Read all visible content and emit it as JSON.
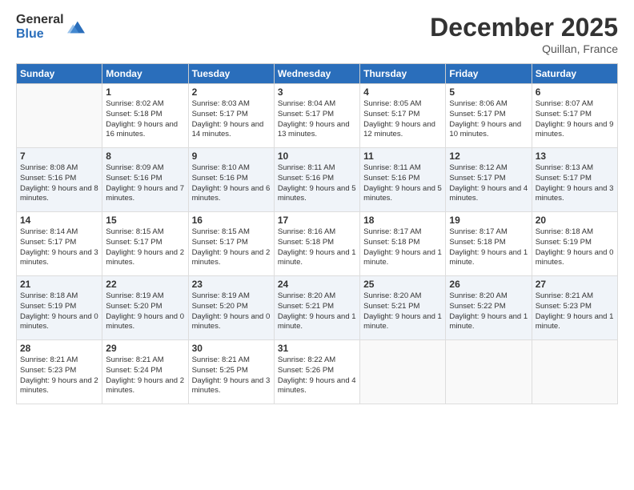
{
  "header": {
    "logo_general": "General",
    "logo_blue": "Blue",
    "title": "December 2025",
    "location": "Quillan, France"
  },
  "weekdays": [
    "Sunday",
    "Monday",
    "Tuesday",
    "Wednesday",
    "Thursday",
    "Friday",
    "Saturday"
  ],
  "weeks": [
    [
      {
        "day": "",
        "sunrise": "",
        "sunset": "",
        "daylight": ""
      },
      {
        "day": "1",
        "sunrise": "Sunrise: 8:02 AM",
        "sunset": "Sunset: 5:18 PM",
        "daylight": "Daylight: 9 hours and 16 minutes."
      },
      {
        "day": "2",
        "sunrise": "Sunrise: 8:03 AM",
        "sunset": "Sunset: 5:17 PM",
        "daylight": "Daylight: 9 hours and 14 minutes."
      },
      {
        "day": "3",
        "sunrise": "Sunrise: 8:04 AM",
        "sunset": "Sunset: 5:17 PM",
        "daylight": "Daylight: 9 hours and 13 minutes."
      },
      {
        "day": "4",
        "sunrise": "Sunrise: 8:05 AM",
        "sunset": "Sunset: 5:17 PM",
        "daylight": "Daylight: 9 hours and 12 minutes."
      },
      {
        "day": "5",
        "sunrise": "Sunrise: 8:06 AM",
        "sunset": "Sunset: 5:17 PM",
        "daylight": "Daylight: 9 hours and 10 minutes."
      },
      {
        "day": "6",
        "sunrise": "Sunrise: 8:07 AM",
        "sunset": "Sunset: 5:17 PM",
        "daylight": "Daylight: 9 hours and 9 minutes."
      }
    ],
    [
      {
        "day": "7",
        "sunrise": "Sunrise: 8:08 AM",
        "sunset": "Sunset: 5:16 PM",
        "daylight": "Daylight: 9 hours and 8 minutes."
      },
      {
        "day": "8",
        "sunrise": "Sunrise: 8:09 AM",
        "sunset": "Sunset: 5:16 PM",
        "daylight": "Daylight: 9 hours and 7 minutes."
      },
      {
        "day": "9",
        "sunrise": "Sunrise: 8:10 AM",
        "sunset": "Sunset: 5:16 PM",
        "daylight": "Daylight: 9 hours and 6 minutes."
      },
      {
        "day": "10",
        "sunrise": "Sunrise: 8:11 AM",
        "sunset": "Sunset: 5:16 PM",
        "daylight": "Daylight: 9 hours and 5 minutes."
      },
      {
        "day": "11",
        "sunrise": "Sunrise: 8:11 AM",
        "sunset": "Sunset: 5:16 PM",
        "daylight": "Daylight: 9 hours and 5 minutes."
      },
      {
        "day": "12",
        "sunrise": "Sunrise: 8:12 AM",
        "sunset": "Sunset: 5:17 PM",
        "daylight": "Daylight: 9 hours and 4 minutes."
      },
      {
        "day": "13",
        "sunrise": "Sunrise: 8:13 AM",
        "sunset": "Sunset: 5:17 PM",
        "daylight": "Daylight: 9 hours and 3 minutes."
      }
    ],
    [
      {
        "day": "14",
        "sunrise": "Sunrise: 8:14 AM",
        "sunset": "Sunset: 5:17 PM",
        "daylight": "Daylight: 9 hours and 3 minutes."
      },
      {
        "day": "15",
        "sunrise": "Sunrise: 8:15 AM",
        "sunset": "Sunset: 5:17 PM",
        "daylight": "Daylight: 9 hours and 2 minutes."
      },
      {
        "day": "16",
        "sunrise": "Sunrise: 8:15 AM",
        "sunset": "Sunset: 5:17 PM",
        "daylight": "Daylight: 9 hours and 2 minutes."
      },
      {
        "day": "17",
        "sunrise": "Sunrise: 8:16 AM",
        "sunset": "Sunset: 5:18 PM",
        "daylight": "Daylight: 9 hours and 1 minute."
      },
      {
        "day": "18",
        "sunrise": "Sunrise: 8:17 AM",
        "sunset": "Sunset: 5:18 PM",
        "daylight": "Daylight: 9 hours and 1 minute."
      },
      {
        "day": "19",
        "sunrise": "Sunrise: 8:17 AM",
        "sunset": "Sunset: 5:18 PM",
        "daylight": "Daylight: 9 hours and 1 minute."
      },
      {
        "day": "20",
        "sunrise": "Sunrise: 8:18 AM",
        "sunset": "Sunset: 5:19 PM",
        "daylight": "Daylight: 9 hours and 0 minutes."
      }
    ],
    [
      {
        "day": "21",
        "sunrise": "Sunrise: 8:18 AM",
        "sunset": "Sunset: 5:19 PM",
        "daylight": "Daylight: 9 hours and 0 minutes."
      },
      {
        "day": "22",
        "sunrise": "Sunrise: 8:19 AM",
        "sunset": "Sunset: 5:20 PM",
        "daylight": "Daylight: 9 hours and 0 minutes."
      },
      {
        "day": "23",
        "sunrise": "Sunrise: 8:19 AM",
        "sunset": "Sunset: 5:20 PM",
        "daylight": "Daylight: 9 hours and 0 minutes."
      },
      {
        "day": "24",
        "sunrise": "Sunrise: 8:20 AM",
        "sunset": "Sunset: 5:21 PM",
        "daylight": "Daylight: 9 hours and 1 minute."
      },
      {
        "day": "25",
        "sunrise": "Sunrise: 8:20 AM",
        "sunset": "Sunset: 5:21 PM",
        "daylight": "Daylight: 9 hours and 1 minute."
      },
      {
        "day": "26",
        "sunrise": "Sunrise: 8:20 AM",
        "sunset": "Sunset: 5:22 PM",
        "daylight": "Daylight: 9 hours and 1 minute."
      },
      {
        "day": "27",
        "sunrise": "Sunrise: 8:21 AM",
        "sunset": "Sunset: 5:23 PM",
        "daylight": "Daylight: 9 hours and 1 minute."
      }
    ],
    [
      {
        "day": "28",
        "sunrise": "Sunrise: 8:21 AM",
        "sunset": "Sunset: 5:23 PM",
        "daylight": "Daylight: 9 hours and 2 minutes."
      },
      {
        "day": "29",
        "sunrise": "Sunrise: 8:21 AM",
        "sunset": "Sunset: 5:24 PM",
        "daylight": "Daylight: 9 hours and 2 minutes."
      },
      {
        "day": "30",
        "sunrise": "Sunrise: 8:21 AM",
        "sunset": "Sunset: 5:25 PM",
        "daylight": "Daylight: 9 hours and 3 minutes."
      },
      {
        "day": "31",
        "sunrise": "Sunrise: 8:22 AM",
        "sunset": "Sunset: 5:26 PM",
        "daylight": "Daylight: 9 hours and 4 minutes."
      },
      {
        "day": "",
        "sunrise": "",
        "sunset": "",
        "daylight": ""
      },
      {
        "day": "",
        "sunrise": "",
        "sunset": "",
        "daylight": ""
      },
      {
        "day": "",
        "sunrise": "",
        "sunset": "",
        "daylight": ""
      }
    ]
  ],
  "accent_color": "#2a6ebb"
}
